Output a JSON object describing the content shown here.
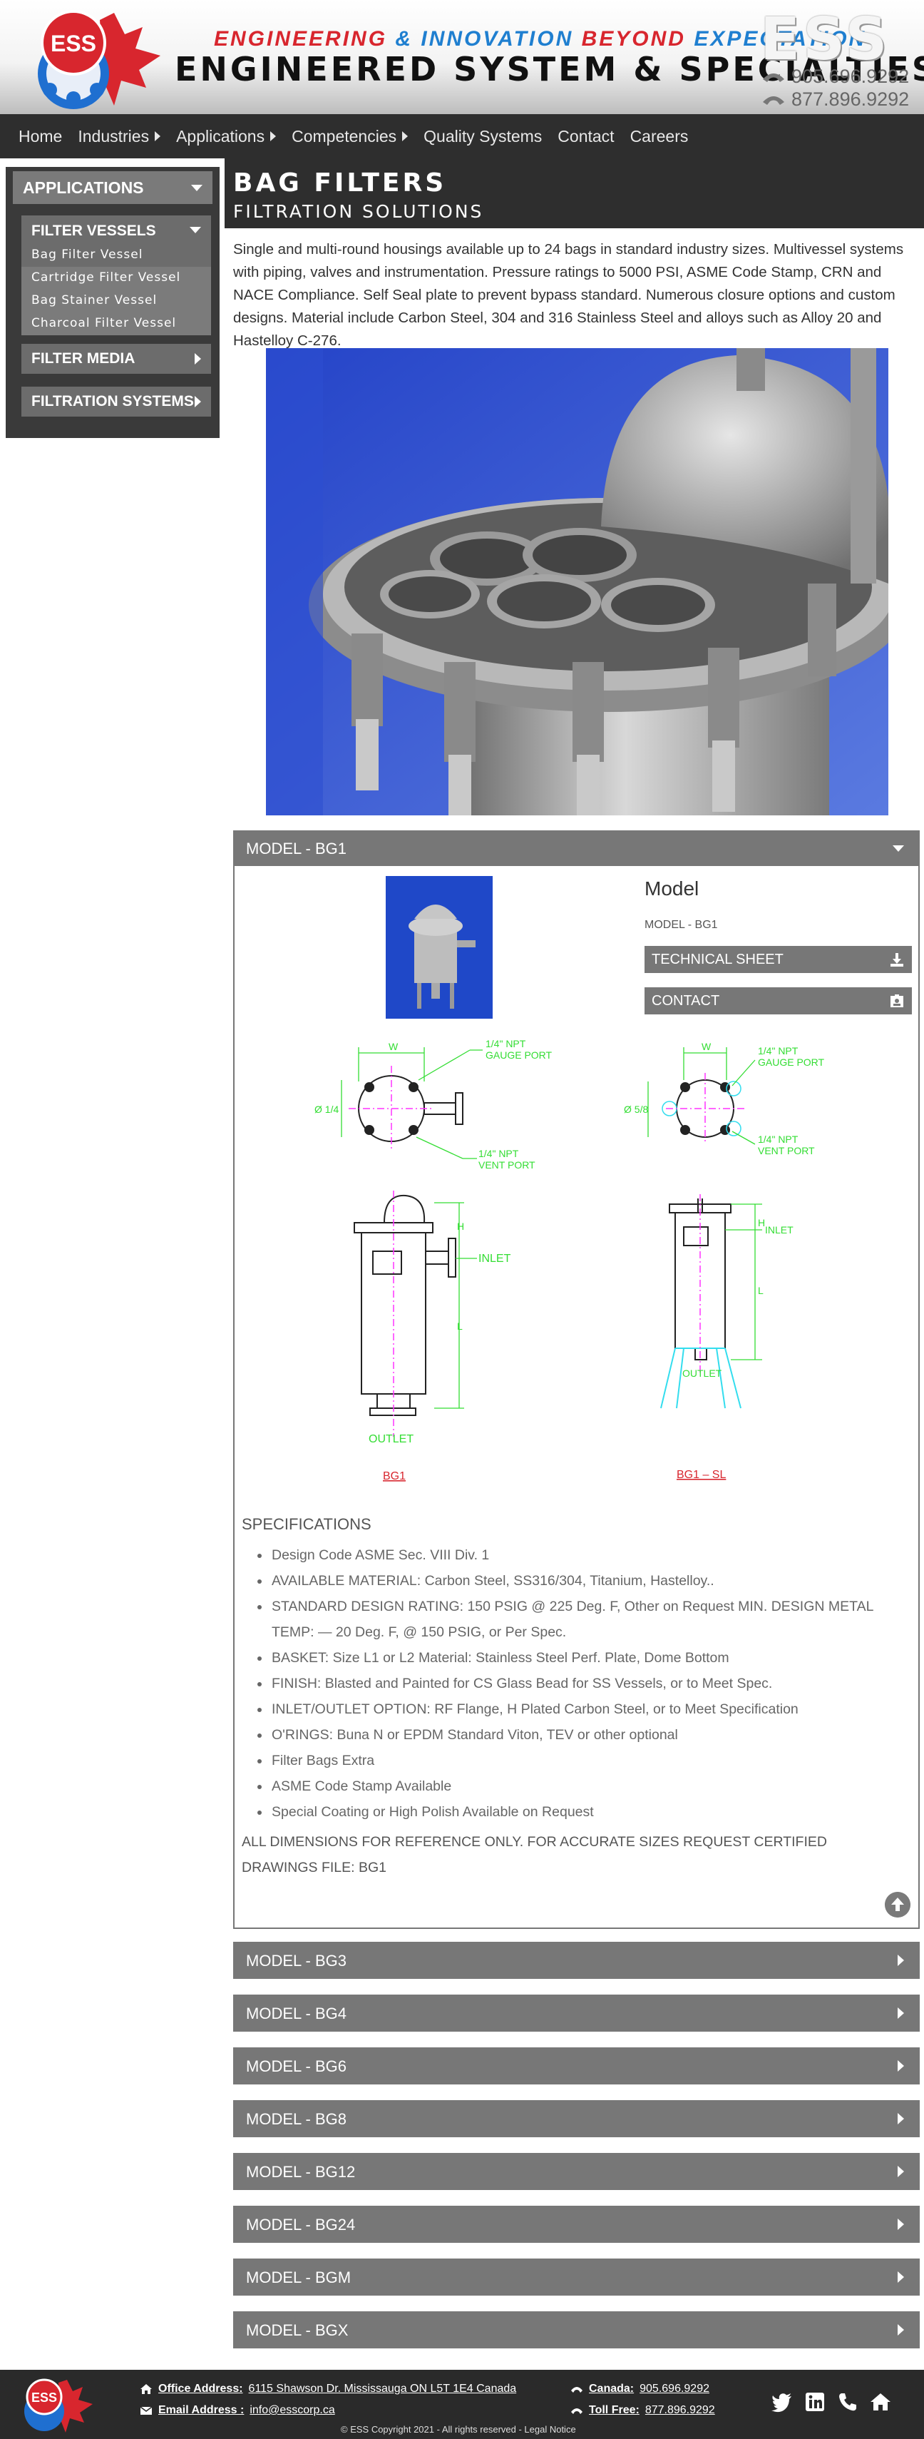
{
  "header": {
    "logo_text": "ESS",
    "tagline": {
      "w1": "ENGINEERING",
      "w2": "& INNOVATION",
      "w3": "BEYOND",
      "w4": "EXPECTATION"
    },
    "company_name": "ENGINEERED SYSTEM & SPECIALTIES",
    "brand_mark": "ESS",
    "phone_local": "905.696.9292",
    "phone_toll": "877.896.9292"
  },
  "nav": {
    "items": [
      {
        "label": "Home"
      },
      {
        "label": "Industries"
      },
      {
        "label": "Applications"
      },
      {
        "label": "Competencies"
      },
      {
        "label": "Quality Systems"
      },
      {
        "label": "Contact"
      },
      {
        "label": "Careers"
      }
    ]
  },
  "sidebar": {
    "heading": "APPLICATIONS",
    "filter_vessels": {
      "label": "FILTER VESSELS",
      "items": [
        "Bag Filter Vessel",
        "Cartridge Filter Vessel",
        "Bag Stainer Vessel",
        "Charcoal Filter Vessel"
      ]
    },
    "filter_media": "FILTER MEDIA",
    "filtration_systems": "FILTRATION SYSTEMS"
  },
  "page": {
    "title": "BAG FILTERS",
    "subtitle": "FILTRATION SOLUTIONS",
    "intro": "Single and multi-round housings available up to 24 bags in standard industry sizes. Multivessel systems with piping, valves and instrumentation. Pressure ratings to 5000 PSI, ASME Code Stamp, CRN and NACE Compliance. Self Seal plate to prevent bypass standard. Numerous closure options and custom designs. Material include Carbon Steel, 304 and 316 Stainless Steel and alloys such as Alloy 20 and Hastelloy C-276."
  },
  "model_open": {
    "header": "MODEL - BG1",
    "heading": "Model",
    "model_label": "MODEL - BG1",
    "technical_sheet": "TECHNICAL SHEET",
    "contact": "CONTACT",
    "drawing_labels": {
      "gauge_port": [
        "1/4\" NPT",
        "GAUGE PORT"
      ],
      "vent_port": [
        "1/4\" NPT",
        "VENT PORT"
      ],
      "w": "W",
      "dia1": "Ø 1/4",
      "dia2": "Ø 5/8",
      "h": "H",
      "l": "L",
      "inlet": "INLET",
      "outlet": "OUTLET",
      "bg1": "BG1",
      "bg1sl": "BG1 – SL"
    },
    "spec_heading": "SPECIFICATIONS",
    "specs": [
      "Design Code ASME Sec. VIII Div. 1",
      "AVAILABLE MATERIAL: Carbon Steel, SS316/304, Titanium, Hastelloy..",
      "STANDARD DESIGN RATING: 150 PSIG @ 225 Deg. F, Other on Request MIN. DESIGN METAL TEMP: — 20 Deg. F, @ 150 PSIG, or Per Spec.",
      "BASKET: Size L1 or L2 Material: Stainless Steel Perf. Plate, Dome Bottom",
      "FINISH: Blasted and Painted for CS Glass Bead for SS Vessels, or to Meet Spec.",
      "INLET/OUTLET OPTION: RF Flange, H Plated Carbon Steel, or to Meet Specification",
      "O'RINGS: Buna N or EPDM Standard Viton, TEV or other optional",
      "Filter Bags Extra",
      "ASME Code Stamp Available",
      "Special Coating or High Polish Available on Request"
    ],
    "note": "ALL DIMENSIONS FOR REFERENCE ONLY. FOR ACCURATE SIZES REQUEST CERTIFIED DRAWINGS FILE: BG1"
  },
  "models_closed": [
    "MODEL - BG3",
    "MODEL - BG4",
    "MODEL - BG6",
    "MODEL - BG8",
    "MODEL - BG12",
    "MODEL - BG24",
    "MODEL - BGM",
    "MODEL - BGX"
  ],
  "footer": {
    "logo_text": "ESS",
    "office_label": "Office Address:",
    "office_value": "6115 Shawson Dr. Mississauga ON L5T 1E4 Canada",
    "email_label": "Email Address :",
    "email_value": "info@esscorp.ca",
    "canada_label": "Canada:",
    "canada_value": "905.696.9292",
    "toll_label": "Toll Free:",
    "toll_value": "877.896.9292",
    "copyright": "© ESS Copyright 2021 - All rights reserved - Legal Notice"
  },
  "colors": {
    "nav_bg": "#2e2e2e",
    "accordion": "#777777",
    "brand_red": "#d8262e",
    "brand_blue": "#1f7fd0",
    "drawing_green": "#33dd33"
  }
}
